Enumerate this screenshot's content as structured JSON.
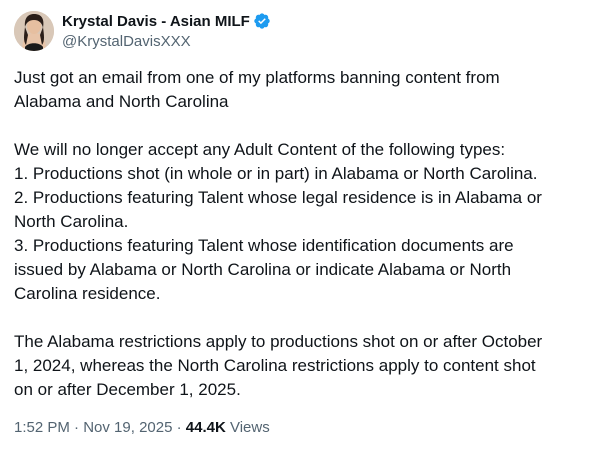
{
  "author": {
    "display_name": "Krystal Davis - Asian MILF",
    "handle": "@KrystalDavisXXX",
    "verified": true,
    "verified_color": "#1d9bf0"
  },
  "tweet": {
    "paragraphs": [
      {
        "lines": [
          "Just got an email from one of my platforms banning content from",
          "Alabama and North Carolina"
        ]
      },
      {
        "lines": [
          "We will no longer accept any Adult Content of the following types:",
          "1. Productions shot (in whole or in part) in Alabama or North Carolina.",
          "2. Productions featuring Talent whose legal residence is in Alabama or",
          "North Carolina.",
          "3. Productions featuring Talent whose identification documents are",
          "issued by Alabama or North Carolina or indicate Alabama or North",
          "Carolina residence."
        ]
      },
      {
        "lines": [
          "The Alabama restrictions apply to productions shot on or after October",
          "1, 2024, whereas the North Carolina restrictions apply to content shot",
          "on or after December 1, 2025."
        ]
      }
    ]
  },
  "meta": {
    "time": "1:52 PM",
    "separator": " · ",
    "date": "Nov 19, 2025",
    "views_count": "44.4K",
    "views_label": " Views"
  }
}
